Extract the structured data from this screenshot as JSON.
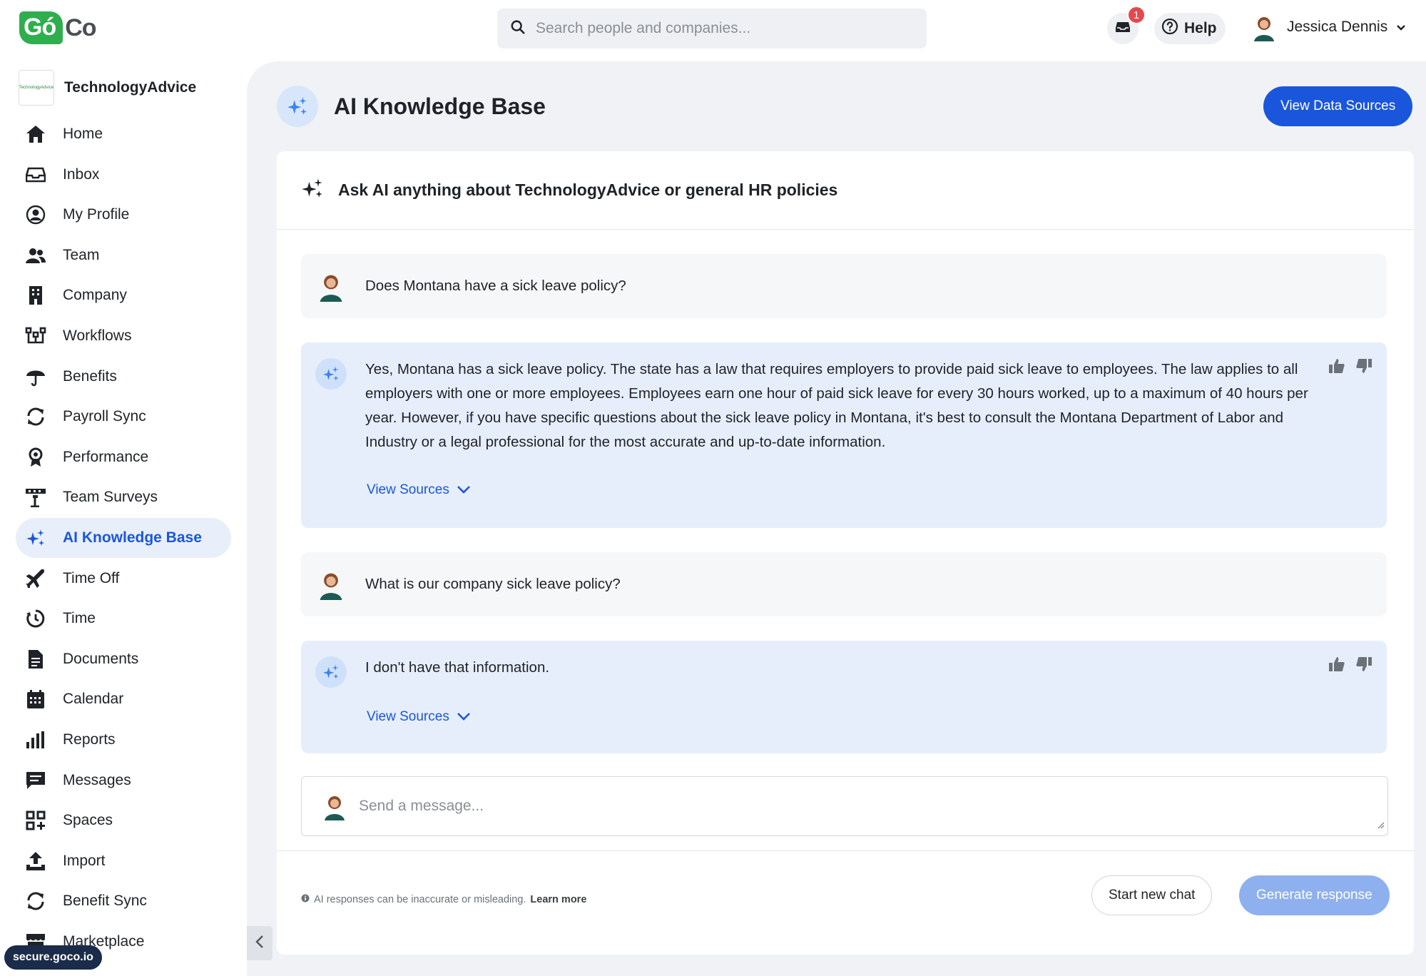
{
  "brand": {
    "logo_go": "Gó",
    "logo_co": "Co"
  },
  "search": {
    "placeholder": "Search people and companies..."
  },
  "header": {
    "inbox_badge": "1",
    "help_label": "Help",
    "user_name": "Jessica Dennis"
  },
  "sidebar": {
    "org_name": "TechnologyAdvice",
    "org_logo_text": "TechnologyAdvice",
    "items": [
      {
        "label": "Home",
        "icon": "home-icon"
      },
      {
        "label": "Inbox",
        "icon": "inbox-icon"
      },
      {
        "label": "My Profile",
        "icon": "profile-icon"
      },
      {
        "label": "Team",
        "icon": "team-icon"
      },
      {
        "label": "Company",
        "icon": "building-icon"
      },
      {
        "label": "Workflows",
        "icon": "workflow-icon"
      },
      {
        "label": "Benefits",
        "icon": "umbrella-icon"
      },
      {
        "label": "Payroll Sync",
        "icon": "sync-icon"
      },
      {
        "label": "Performance",
        "icon": "award-icon"
      },
      {
        "label": "Team Surveys",
        "icon": "survey-icon"
      },
      {
        "label": "AI Knowledge Base",
        "icon": "sparkle-icon",
        "active": true
      },
      {
        "label": "Time Off",
        "icon": "plane-icon"
      },
      {
        "label": "Time",
        "icon": "clock-icon"
      },
      {
        "label": "Documents",
        "icon": "document-icon"
      },
      {
        "label": "Calendar",
        "icon": "calendar-icon"
      },
      {
        "label": "Reports",
        "icon": "reports-icon"
      },
      {
        "label": "Messages",
        "icon": "messages-icon"
      },
      {
        "label": "Spaces",
        "icon": "spaces-icon"
      },
      {
        "label": "Import",
        "icon": "import-icon"
      },
      {
        "label": "Benefit Sync",
        "icon": "sync-icon"
      },
      {
        "label": "Marketplace",
        "icon": "store-icon"
      }
    ],
    "url_tooltip": "secure.goco.io"
  },
  "page": {
    "title": "AI Knowledge Base",
    "view_sources_button": "View Data Sources",
    "card_title": "Ask AI anything about TechnologyAdvice or general HR policies"
  },
  "conversation": [
    {
      "role": "user",
      "text": "Does Montana have a sick leave policy?"
    },
    {
      "role": "ai",
      "text": "Yes, Montana has a sick leave policy. The state has a law that requires employers to provide paid sick leave to employees. The law applies to all employers with one or more employees. Employees earn one hour of paid sick leave for every 30 hours worked, up to a maximum of 40 hours per year. However, if you have specific questions about the sick leave policy in Montana, it's best to consult the Montana Department of Labor and Industry or a legal professional for the most accurate and up-to-date information.",
      "sources_label": "View Sources"
    },
    {
      "role": "user",
      "text": "What is our company sick leave policy?"
    },
    {
      "role": "ai",
      "text": "I don't have that information.",
      "sources_label": "View Sources"
    }
  ],
  "composer": {
    "placeholder": "Send a message..."
  },
  "footer": {
    "disclaimer": "AI responses can be inaccurate or misleading.",
    "learn_more": "Learn more",
    "new_chat_button": "Start new chat",
    "generate_button": "Generate response"
  },
  "colors": {
    "accent": "#1a56db",
    "ai_bubble": "#e7eefb",
    "brand_green": "#2fae4e",
    "badge_red": "#e5484d"
  }
}
